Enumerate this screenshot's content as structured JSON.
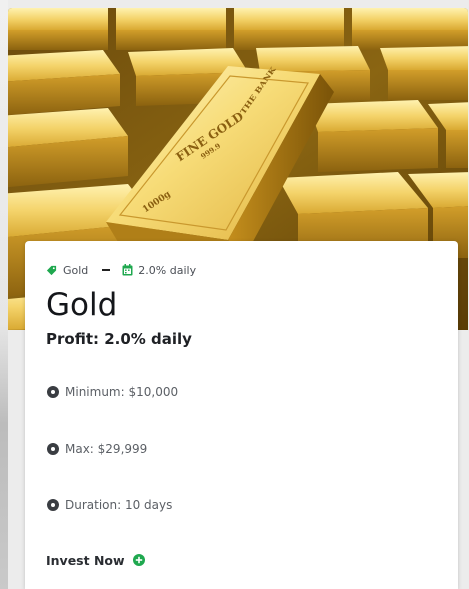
{
  "meta": {
    "category": "Gold",
    "rate": "2.0% daily"
  },
  "card": {
    "title": "Gold",
    "profit": "Profit: 2.0% daily",
    "minimum": "Minimum: $10,000",
    "max": "Max: $29,999",
    "duration": "Duration: 10 days",
    "cta": "Invest Now"
  },
  "hero": {
    "bar_stamp_brand": "THE BANK",
    "bar_stamp_main": "FINE GOLD",
    "bar_stamp_purity": "999.9",
    "bar_stamp_weight": "1000g"
  },
  "colors": {
    "accent_green": "#1fa84f",
    "bullet_dark": "#3a3d42",
    "gold_light": "#f7dc78",
    "gold_dark": "#6a4a08"
  },
  "icons": {
    "category": "tag-icon",
    "rate": "calendar-icon",
    "bullets": "dot-circle-icon",
    "cta": "plus-circle-icon"
  }
}
